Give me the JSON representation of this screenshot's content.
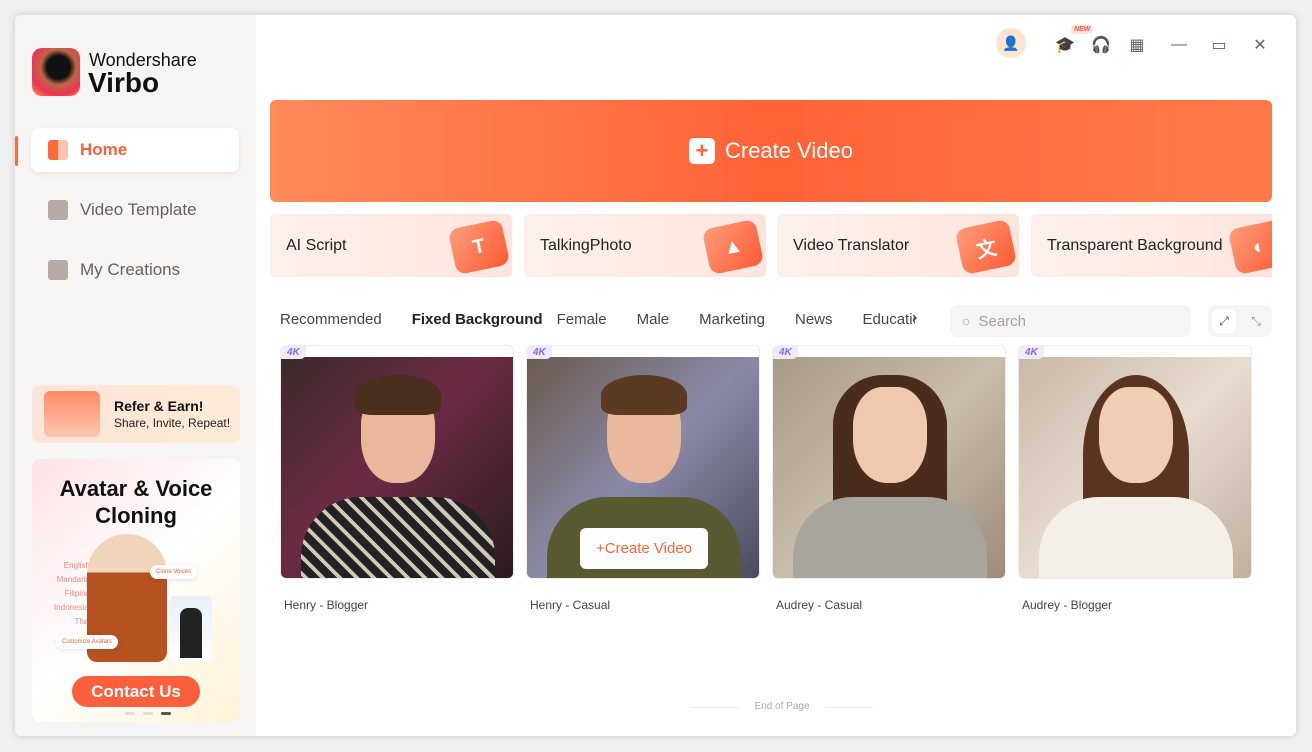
{
  "app": {
    "brand_top": "Wondershare",
    "brand_bottom": "Virbo"
  },
  "sidebar": {
    "items": [
      {
        "label": "Home",
        "icon": "home-icon",
        "active": true
      },
      {
        "label": "Video Template",
        "icon": "template-icon"
      },
      {
        "label": "My Creations",
        "icon": "creations-icon"
      }
    ],
    "refer": {
      "title": "Refer & Earn!",
      "subtitle": "Share, Invite, Repeat!"
    },
    "promo": {
      "title": "Avatar & Voice Cloning",
      "languages": [
        "English",
        "Mandarin",
        "Filipino",
        "Indonesian",
        "Thai"
      ],
      "chip_clone": "Clone Voices",
      "chip_customize": "Customize Avatars",
      "button": "Contact Us",
      "carousel_index": 3,
      "carousel_total": 3
    }
  },
  "topbar": {
    "new_badge": "NEW",
    "icons": [
      "user-icon",
      "academy-icon",
      "support-icon",
      "apps-icon",
      "minimize-icon",
      "maximize-icon",
      "close-icon"
    ]
  },
  "main": {
    "create_video": "Create Video",
    "tools": [
      {
        "label": "AI Script"
      },
      {
        "label": "TalkingPhoto"
      },
      {
        "label": "Video Translator"
      },
      {
        "label": "Transparent Background"
      }
    ],
    "tabs": [
      "Recommended",
      "Fixed Background",
      "Female",
      "Male",
      "Marketing",
      "News",
      "Education"
    ],
    "active_tab": "Fixed Background",
    "search_placeholder": "Search",
    "avatars": [
      {
        "name": "Henry - Blogger",
        "badge": "4K"
      },
      {
        "name": "Henry - Casual",
        "badge": "4K",
        "hover_button": "Create Video"
      },
      {
        "name": "Audrey - Casual",
        "badge": "4K"
      },
      {
        "name": "Audrey - Blogger",
        "badge": "4K"
      }
    ],
    "end_text": "End of Page"
  },
  "colors": {
    "accent": "#ff6338",
    "sidebar_bg": "#f7f5f3",
    "badge": "#8a6bf5"
  }
}
